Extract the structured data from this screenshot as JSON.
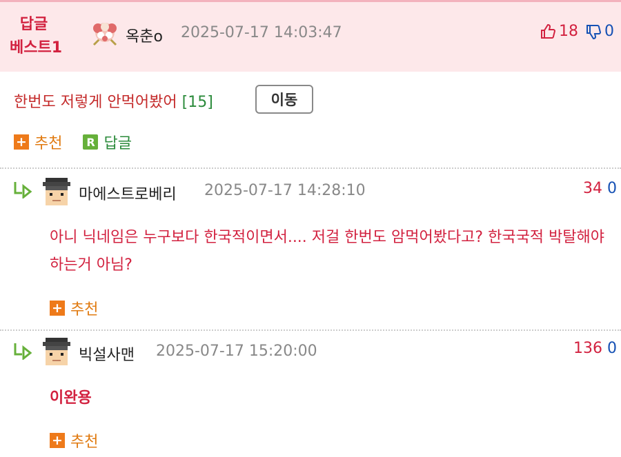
{
  "best": {
    "badge_line1": "답글",
    "badge_line2": "베스트1",
    "author": "옥춘o",
    "date": "2025-07-17 14:03:47",
    "up": "18",
    "down": "0"
  },
  "thread": {
    "title": "한번도 저렇게 안먹어봤어",
    "count": "[15]",
    "move_label": "이동"
  },
  "actions": {
    "recommend": "추천",
    "reply": "답글",
    "reply_icon": "R"
  },
  "comments": [
    {
      "author": "마에스트로베리",
      "date": "2025-07-17 14:28:10",
      "up": "34",
      "down": "0",
      "text": "아니 닉네임은 누구보다 한국적이면서.... 저걸 한번도 암먹어봤다고? 한국국적 박탈해야 하는거 아님?",
      "recommend": "추천"
    },
    {
      "author": "빅설사맨",
      "date": "2025-07-17 15:20:00",
      "up": "136",
      "down": "0",
      "text": "이완용",
      "recommend": "추천"
    }
  ],
  "icons": {
    "plus": "+",
    "thumb_up": "thumbs-up-icon",
    "thumb_down": "thumbs-down-icon",
    "reply_arrow": "reply-arrow-icon"
  },
  "colors": {
    "accent_red": "#d2213f",
    "down_blue": "#1450b4",
    "best_bg": "#fde8ea",
    "recommend_orange": "#ee7a1a",
    "reply_green": "#66b03a"
  }
}
